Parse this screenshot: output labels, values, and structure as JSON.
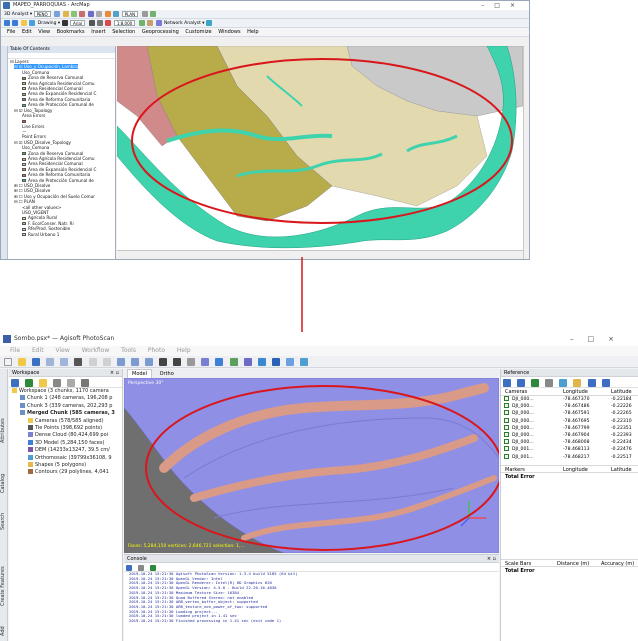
{
  "arcmap": {
    "title": "MAPEO_PARROQUIAS - ArcMap",
    "toolbar_rows": [
      "3D Analyst ▾  PENO  ▾  ...",
      "Drawing ▾  ...  Arial  ▾  ...",
      "Georeferencing ▾  Network Analyst ▾  PLAN  ..."
    ],
    "combo_values": [
      "PENO",
      "Arial",
      "1:8,000",
      "PLAN"
    ],
    "menu": [
      "File",
      "Edit",
      "View",
      "Bookmarks",
      "Insert",
      "Selection",
      "Geoprocessing",
      "Customize",
      "Windows",
      "Help"
    ],
    "toc_title": "Table Of Contents",
    "toc_items": [
      {
        "text": "⊟ Layers",
        "swatch": null,
        "indent": 0
      },
      {
        "text": "⊟ ☑ Uso_y Ocupación_Lambra",
        "swatch": null,
        "indent": 1,
        "selected": true
      },
      {
        "text": "Uso_Comuna",
        "swatch": null,
        "indent": 3
      },
      {
        "text": "Zona de Reserva Comunal",
        "swatch": "#6aa84f",
        "indent": 3
      },
      {
        "text": "Área Agrícola Residencial Comu",
        "swatch": "#cbbf7a",
        "indent": 3
      },
      {
        "text": "Área Residencial Comunal",
        "swatch": "#d8cfa0",
        "indent": 3
      },
      {
        "text": "Área de Expansión Residencial C",
        "swatch": "#c9a070",
        "indent": 3
      },
      {
        "text": "Área de Reforma Comunitaria",
        "swatch": "#b87a7a",
        "indent": 3
      },
      {
        "text": "Área de Protección Comunal de",
        "swatch": "#2ec9a4",
        "indent": 3
      },
      {
        "text": "⊟ ☑ Uso_Topology",
        "swatch": null,
        "indent": 1
      },
      {
        "text": "Area Errors",
        "swatch": null,
        "indent": 3
      },
      {
        "text": "",
        "swatch": "#ff3b3b",
        "indent": 3
      },
      {
        "text": "Line Errors",
        "swatch": null,
        "indent": 3
      },
      {
        "text": "—",
        "swatch": null,
        "indent": 3
      },
      {
        "text": "Point Errors",
        "swatch": null,
        "indent": 3
      },
      {
        "text": "⊟ ☑ USO_Disolve_Topology",
        "swatch": null,
        "indent": 1
      },
      {
        "text": "Uso_Comuna",
        "swatch": null,
        "indent": 3
      },
      {
        "text": "Zona de Reserva Comunal",
        "swatch": "#6aa84f",
        "indent": 3
      },
      {
        "text": "Área Agrícola Residencial Comu",
        "swatch": "#cbbf7a",
        "indent": 3
      },
      {
        "text": "Área Residencial Comunal",
        "swatch": "#d8cfa0",
        "indent": 3
      },
      {
        "text": "Área de Expansión Residencial C",
        "swatch": "#c9a070",
        "indent": 3
      },
      {
        "text": "Área de Reforma Comunitaria",
        "swatch": "#b87a7a",
        "indent": 3
      },
      {
        "text": "Área de Protección Comunal de",
        "swatch": "#2ec9a4",
        "indent": 3
      },
      {
        "text": "⊞ ☐ USO_Disolve",
        "swatch": null,
        "indent": 1
      },
      {
        "text": "⊞ ☐ USO_Disolve",
        "swatch": null,
        "indent": 1
      },
      {
        "text": "⊞ ☐ Uso y Ocupación del Suelo Comur",
        "swatch": null,
        "indent": 1
      },
      {
        "text": "⊟ ☐ PLAN",
        "swatch": null,
        "indent": 1
      },
      {
        "text": "<all other values>",
        "swatch": null,
        "indent": 3
      },
      {
        "text": "USO_VIGENT",
        "swatch": null,
        "indent": 3
      },
      {
        "text": "Agrícola Rural",
        "swatch": "#e8e1a8",
        "indent": 3
      },
      {
        "text": "F. Eco/Conser. Natr. Ri",
        "swatch": "#9fd38a",
        "indent": 3
      },
      {
        "text": "Rfe/Prod. Sostenible",
        "swatch": "#c7dfb0",
        "indent": 3
      },
      {
        "text": "Rural Urbano 1",
        "swatch": "#f3c9a8",
        "indent": 3
      }
    ]
  },
  "photoscan": {
    "title": "Sombo.psx* — Agisoft PhotoScan",
    "menu": [
      "File",
      "Edit",
      "View",
      "Workflow",
      "Tools",
      "Photo",
      "Help"
    ],
    "side_tabs": [
      "Attributes",
      "Catalog",
      "Search",
      "Create Features",
      "Add"
    ],
    "workspace": {
      "title": "Workspace",
      "rows": [
        {
          "text": "Workspace (3 chunks, 1170 camera",
          "indent": 0,
          "bold": false,
          "icon": "#f0c94b"
        },
        {
          "text": "Chunk 1 (248 cameras, 196,208 p",
          "indent": 1,
          "bold": false,
          "icon": "#6d8fc7"
        },
        {
          "text": "Chunk 3 (339 cameras, 202,293 p",
          "indent": 1,
          "bold": false,
          "icon": "#6d8fc7"
        },
        {
          "text": "Merged Chunk (585 cameras, 3",
          "indent": 1,
          "bold": true,
          "icon": "#6d8fc7"
        },
        {
          "text": "Cameras (578/585 aligned)",
          "indent": 2,
          "bold": false,
          "icon": "#f0c94b"
        },
        {
          "text": "Tie Points (398,692 points)",
          "indent": 2,
          "bold": false,
          "icon": "#555555"
        },
        {
          "text": "Dense Cloud (80,424,699 poi",
          "indent": 2,
          "bold": false,
          "icon": "#7a7fd1"
        },
        {
          "text": "3D Model (5,284,150 faces)",
          "indent": 2,
          "bold": false,
          "icon": "#3f7fd9"
        },
        {
          "text": "DEM (14233x13247, 39.5 cm/",
          "indent": 2,
          "bold": false,
          "icon": "#7c55a8"
        },
        {
          "text": "Orthomosaic (39799x36108, 9",
          "indent": 2,
          "bold": false,
          "icon": "#4d9fcf"
        },
        {
          "text": "Shapes (5 polygons)",
          "indent": 2,
          "bold": false,
          "icon": "#e8b74b"
        },
        {
          "text": "Contours (29 polylines, 4,041",
          "indent": 2,
          "bold": false,
          "icon": "#9c6c3c"
        }
      ]
    },
    "tabs": [
      "Model",
      "Ortho"
    ],
    "viewport": {
      "label": "Perspective 30°",
      "status": "Faces: 5,284,150 vertices: 2,646,721 selection: 1,..."
    },
    "console": {
      "title": "Console",
      "lines": [
        "2019-10-24 15:21:30 Agisoft PhotoScan Version: 1.3.4 build 5185 (64 bit)",
        "2019-10-24 15:21:30 OpenGL Vendor: Intel",
        "2019-10-24 15:21:30 OpenGL Renderer: Intel(R) HD Graphics 620",
        "2019-10-24 15:21:30 OpenGL Version: 4.5.0 - Build 22.20.16.4836",
        "2019-10-24 15:21:30 Maximum Texture Size: 16384",
        "2019-10-24 15:21:30 Quad Buffered Stereo: not enabled",
        "2019-10-24 15:21:30 ARB_vertex_buffer_object: supported",
        "2019-10-24 15:21:30 ARB_texture_non_power_of_two: supported",
        "2019-10-24 15:21:30 Loading project...",
        "2019-10-24 15:21:30 loaded project in 1.41 sec",
        "2019-10-24 15:21:30 Finished processing in 1.41 sec (exit code 1)"
      ]
    },
    "reference": {
      "title": "Reference",
      "camera_headers": [
        "Cameras",
        "Longitude",
        "Latitude"
      ],
      "cameras": [
        {
          "name": "DJI_000...",
          "lon": "-78.467370",
          "lat": "-0.22184"
        },
        {
          "name": "DJI_000...",
          "lon": "-78.467486",
          "lat": "-0.22226"
        },
        {
          "name": "DJI_000...",
          "lon": "-78.467591",
          "lat": "-0.22265"
        },
        {
          "name": "DJI_000...",
          "lon": "-78.467695",
          "lat": "-0.22310"
        },
        {
          "name": "DJI_000...",
          "lon": "-78.467799",
          "lat": "-0.22351"
        },
        {
          "name": "DJI_000...",
          "lon": "-78.467904",
          "lat": "-0.22393"
        },
        {
          "name": "DJI_000...",
          "lon": "-78.468008",
          "lat": "-0.22434"
        },
        {
          "name": "DJI_001...",
          "lon": "-78.468113",
          "lat": "-0.22476"
        },
        {
          "name": "DJI_001...",
          "lon": "-78.468217",
          "lat": "-0.22517"
        }
      ],
      "marker_headers": [
        "Markers",
        "Longitude",
        "Latitude"
      ],
      "total_error": "Total Error",
      "scalebar_headers": [
        "Scale Bars",
        "Distance (m)",
        "Accuracy (m)"
      ]
    }
  },
  "colors": {
    "map_red": "#d18a8a",
    "map_olive": "#b7ab4a",
    "map_tan": "#e3d9ae",
    "map_gray": "#c9c9c9",
    "map_teal": "#3fd3ad",
    "photoscan_dense": "#8f8fe6",
    "photoscan_river": "#d99a88",
    "ellipse": "#d9161c"
  }
}
